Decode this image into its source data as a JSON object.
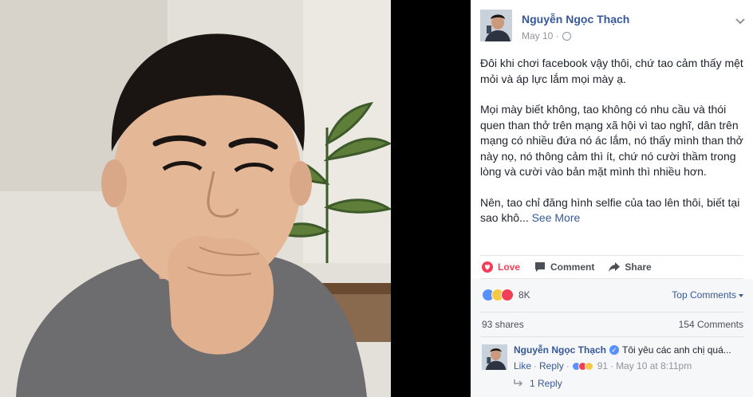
{
  "post": {
    "author": "Nguyễn Ngọc Thạch",
    "date": "May 10 · ",
    "privacy_icon": "globe-icon",
    "paragraphs": [
      "Đôi khi chơi facebook vậy thôi, chứ tao cảm thấy mệt mỏi và áp lực lắm mọi mày ạ.",
      "Mọi mày biết không, tao không có nhu cầu và thói quen than thở trên mạng xã hội vì tao nghĩ, dân trên mạng có nhiều đứa nó ác lắm, nó thấy mình than thở này nọ, nó thông cảm thì ít, chứ nó cười thầm trong lòng và cười vào bản mặt mình thì nhiều hơn.",
      "Nên, tao chỉ đăng hình selfie của tao lên thôi, biết tại sao khô... "
    ],
    "see_more": "See More"
  },
  "actions": {
    "love": "Love",
    "comment": "Comment",
    "share": "Share"
  },
  "feedback": {
    "reaction_count": "8K",
    "top_comments": "Top Comments",
    "shares": "93 shares",
    "comments": "154 Comments"
  },
  "comment": {
    "author": "Nguyễn Ngọc Thạch",
    "text": "Tôi yêu các anh chị quá...",
    "like": "Like",
    "reply": "Reply",
    "reaction_count": "91",
    "timestamp": "May 10 at 8:11pm",
    "replies": "1 Reply"
  },
  "colors": {
    "link": "#365899",
    "love": "#f33e58",
    "like": "#5890ff",
    "haha": "#f7c844"
  }
}
